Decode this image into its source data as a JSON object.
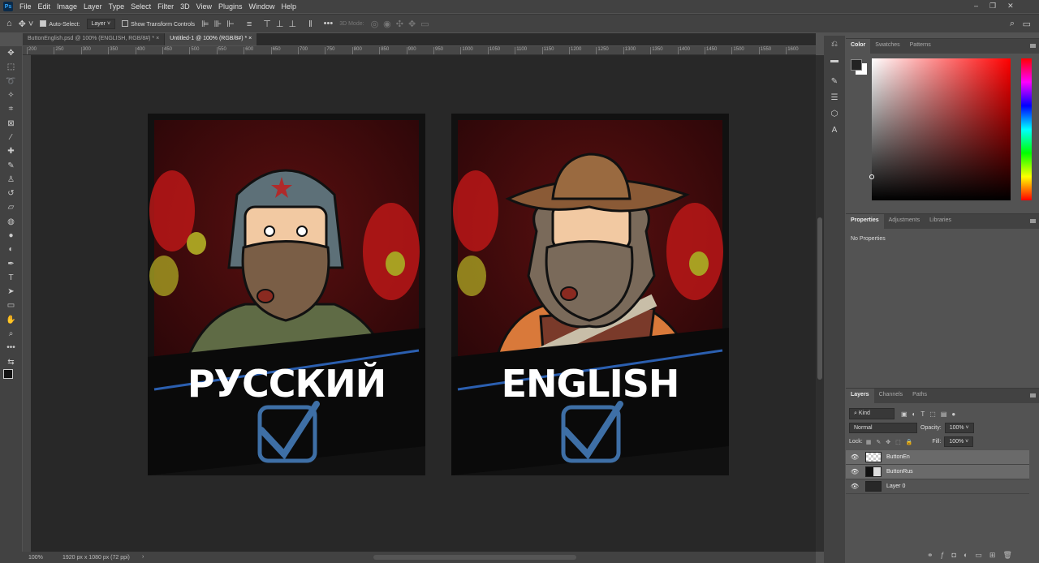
{
  "app": {
    "logo": "Ps"
  },
  "menu": [
    "File",
    "Edit",
    "Image",
    "Layer",
    "Type",
    "Select",
    "Filter",
    "3D",
    "View",
    "Plugins",
    "Window",
    "Help"
  ],
  "options": {
    "auto_select_label": "Auto-Select:",
    "auto_select_value": "Layer",
    "show_transform_label": "Show Transform Controls",
    "mode_3d_label": "3D Mode:",
    "more": "•••"
  },
  "tabs": [
    {
      "label": "ButtonEnglish.psd @ 100% (ENGLISH, RGB/8#) *",
      "active": false
    },
    {
      "label": "Untitled-1 @ 100% (RGB/8#) *",
      "active": true
    }
  ],
  "ruler_ticks": [
    "200",
    "250",
    "300",
    "350",
    "400",
    "450",
    "500",
    "550",
    "600",
    "650",
    "700",
    "750",
    "800",
    "850",
    "900",
    "950",
    "1000",
    "1050",
    "1100",
    "1150",
    "1200",
    "1250",
    "1300",
    "1350",
    "1400",
    "1450",
    "1500",
    "1550",
    "1600"
  ],
  "canvas": {
    "buttons": [
      {
        "label": "РУССКИЙ"
      },
      {
        "label": "ENGLISH"
      }
    ],
    "accent": "#3f6fa8"
  },
  "status": {
    "zoom": "100%",
    "doc_size": "1920 px x 1080 px (72 ppi)"
  },
  "color_panel": {
    "tabs": [
      "Color",
      "Swatches",
      "Patterns"
    ],
    "hue": "#ff0000"
  },
  "properties_panel": {
    "tabs": [
      "Properties",
      "Adjustments",
      "Libraries"
    ],
    "empty_text": "No Properties"
  },
  "layers_panel": {
    "tabs": [
      "Layers",
      "Channels",
      "Paths"
    ],
    "filter": "Kind",
    "blend_mode": "Normal",
    "opacity_label": "Opacity:",
    "opacity": "100%",
    "lock_label": "Lock:",
    "fill_label": "Fill:",
    "fill": "100%",
    "layers": [
      {
        "name": "ButtonEn",
        "selected": true
      },
      {
        "name": "ButtonRus",
        "selected": true
      },
      {
        "name": "Layer 0",
        "selected": false
      }
    ]
  }
}
